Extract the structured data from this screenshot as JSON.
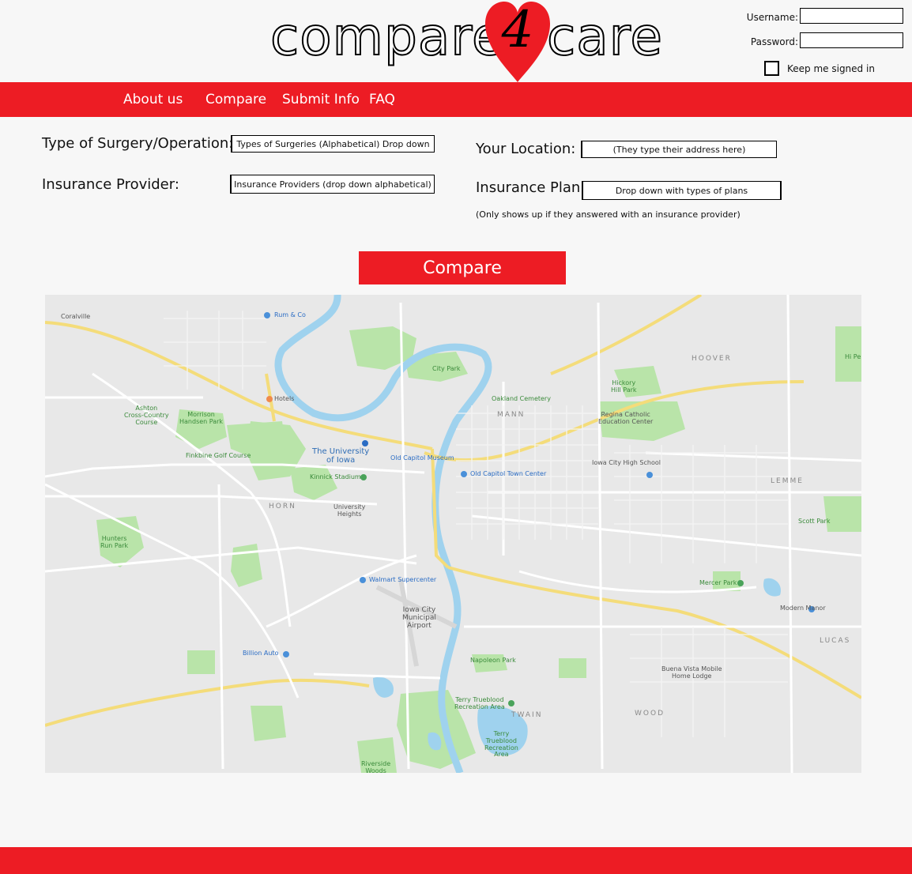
{
  "logo": {
    "left_text": "compare",
    "number": "4",
    "right_text": "care",
    "heart_color": "#ed1c24"
  },
  "login": {
    "username_label": "Username:",
    "password_label": "Password:",
    "keep_signed_in_label": "Keep me signed in"
  },
  "nav": {
    "items": [
      "About us",
      "Compare",
      "Submit Info",
      "FAQ"
    ],
    "color": "#ed1c24"
  },
  "form": {
    "surgery_label": "Type of Surgery/Operation:",
    "surgery_value": "Types of Surgeries (Alphabetical) Drop down",
    "insurance_provider_label": "Insurance Provider:",
    "insurance_provider_value": "Insurance Providers (drop down alphabetical)",
    "location_label": "Your Location:",
    "location_value": "(They type their address here)",
    "plan_label": "Insurance Plan:",
    "plan_value": "Drop down with types of plans",
    "plan_note": "(Only shows up if they answered with an insurance provider)"
  },
  "compare_button": "Compare",
  "map": {
    "places": {
      "coralville": "Coralville",
      "rum_co": "Rum & Co",
      "city_park": "City Park",
      "hoover": "HOOVER",
      "hickory_hill": "Hickory\nHill Park",
      "oakland_cemetery": "Oakland Cemetery",
      "manville": "MANN",
      "regina": "Regina Catholic\nEducation Center",
      "ashton": "Ashton\nCross-Country\nCourse",
      "morrison": "Morrison\nHandsen Park",
      "hotels": "Hotels",
      "finkbine": "Finkbine Golf Course",
      "university": "The University\nof Iowa",
      "old_capitol_museum": "Old Capitol Museum",
      "kinnick": "Kinnick Stadium",
      "old_capitol_center": "Old Capitol Town Center",
      "iowa_city_high": "Iowa City High School",
      "lemme": "LEMME",
      "horn": "HORN",
      "university_heights": "University\nHeights",
      "scott_park": "Scott Park",
      "hunters_run": "Hunters\nRun Park",
      "walmart": "Walmart Supercenter",
      "mercer": "Mercer Park",
      "modern_manor": "Modern Manor",
      "airport": "Iowa City\nMunicipal\nAirport",
      "lucas": "LUCAS",
      "billion_auto": "Billion Auto",
      "napoleon": "Napoleon Park",
      "buena_vista": "Buena Vista Mobile\nHome Lodge",
      "terry_trueblood": "Terry Trueblood\nRecreation Area",
      "twain": "TWAIN",
      "wood": "WOOD",
      "terry_trueblood_2": "Terry\nTrueblood\nRecreation\nArea",
      "riverside": "Riverside\nWoods",
      "hi_pe": "Hi Pe"
    }
  }
}
